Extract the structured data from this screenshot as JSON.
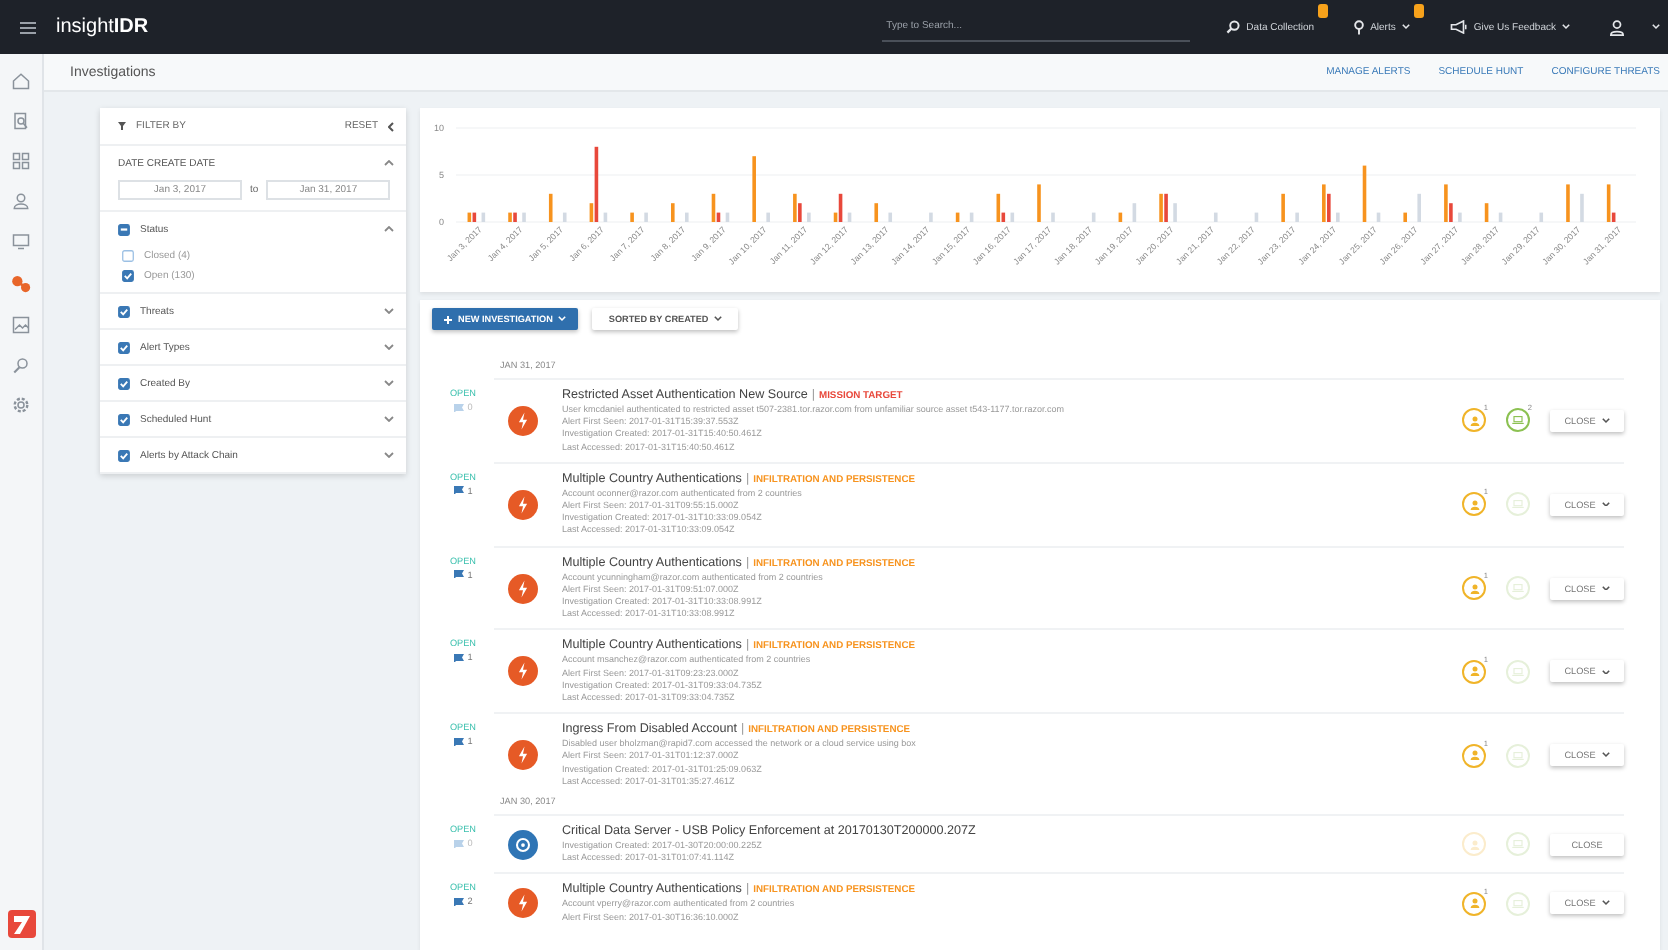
{
  "topbar": {
    "logo": "insight**IDR**",
    "search": {
      "placeholder": "Type to Search..."
    },
    "items": [
      {
        "kind": "collection",
        "label": "Data Collection",
        "badge": true,
        "caret": false
      },
      {
        "kind": "alerts",
        "label": "Alerts",
        "badge": true,
        "caret": true
      },
      {
        "kind": "feedback",
        "label": "Give Us Feedback",
        "badge": false,
        "caret": true
      }
    ]
  },
  "sidebar": {
    "items": [
      {
        "kind": "home",
        "selected": false
      },
      {
        "kind": "report",
        "selected": false
      },
      {
        "kind": "dashboard",
        "selected": false
      },
      {
        "kind": "user",
        "selected": false
      },
      {
        "kind": "monitor",
        "selected": false
      },
      {
        "kind": "investigation",
        "selected": true
      },
      {
        "kind": "image",
        "selected": false
      },
      {
        "kind": "hunt",
        "selected": false
      },
      {
        "kind": "settings",
        "selected": false
      }
    ]
  },
  "header": {
    "title": "Investigations",
    "links": [
      "MANAGE ALERTS",
      "SCHEDULE HUNT",
      "CONFIGURE THREATS"
    ]
  },
  "filter": {
    "title": "FILTER BY",
    "reset": "RESET",
    "date": {
      "label": "DATE CREATE DATE",
      "expanded": true,
      "from": "Jan 3, 2017",
      "separator": "to",
      "to": "Jan 31, 2017"
    },
    "groups": [
      {
        "label": "Status",
        "checked": true,
        "partial": true,
        "expanded": true,
        "options": [
          {
            "label": "Closed (4)",
            "checked": false
          },
          {
            "label": "Open (130)",
            "checked": true
          }
        ]
      },
      {
        "label": "Threats",
        "checked": true,
        "expanded": false
      },
      {
        "label": "Alert Types",
        "checked": true,
        "expanded": false
      },
      {
        "label": "Created By",
        "checked": true,
        "expanded": false
      },
      {
        "label": "Scheduled Hunt",
        "checked": true,
        "expanded": false
      },
      {
        "label": "Alerts by Attack Chain",
        "checked": true,
        "expanded": false
      }
    ]
  },
  "chart_data": {
    "type": "bar",
    "ylim": [
      0,
      10
    ],
    "yticks": [
      0,
      5,
      10
    ],
    "categories": [
      "Jan 3, 2017",
      "Jan 4, 2017",
      "Jan 5, 2017",
      "Jan 6, 2017",
      "Jan 7, 2017",
      "Jan 8, 2017",
      "Jan 9, 2017",
      "Jan 10, 2017",
      "Jan 11, 2017",
      "Jan 12, 2017",
      "Jan 13, 2017",
      "Jan 14, 2017",
      "Jan 15, 2017",
      "Jan 16, 2017",
      "Jan 17, 2017",
      "Jan 18, 2017",
      "Jan 19, 2017",
      "Jan 20, 2017",
      "Jan 21, 2017",
      "Jan 22, 2017",
      "Jan 23, 2017",
      "Jan 24, 2017",
      "Jan 25, 2017",
      "Jan 26, 2017",
      "Jan 27, 2017",
      "Jan 28, 2017",
      "Jan 29, 2017",
      "Jan 30, 2017",
      "Jan 31, 2017"
    ],
    "series": [
      {
        "color": "#f7931e",
        "values": [
          1,
          1,
          3,
          2,
          1,
          2,
          3,
          7,
          3,
          1,
          2,
          0,
          1,
          3,
          4,
          0,
          1,
          3,
          0,
          0,
          3,
          4,
          6,
          1,
          4,
          2,
          0,
          4,
          4
        ]
      },
      {
        "color": "#e8483b",
        "values": [
          1,
          1,
          0,
          8,
          0,
          0,
          1,
          0,
          2,
          3,
          0,
          0,
          0,
          1,
          0,
          0,
          0,
          3,
          0,
          0,
          0,
          3,
          0,
          0,
          2,
          0,
          0,
          0,
          1
        ]
      },
      {
        "color": "#d3dae3",
        "values": [
          1,
          1,
          1,
          1,
          1,
          1,
          1,
          1,
          1,
          1,
          1,
          1,
          1,
          1,
          1,
          1,
          2,
          2,
          1,
          1,
          1,
          1,
          1,
          3,
          1,
          1,
          1,
          3,
          0
        ]
      }
    ]
  },
  "actions": {
    "new_button": "NEW INVESTIGATION",
    "sort_button": "SORTED BY CREATED"
  },
  "groups": [
    {
      "date": "JAN 31, 2017",
      "items": [
        {
          "status": "OPEN",
          "flags": "0",
          "flagged": false,
          "kind": "alert",
          "title": "Restricted Asset Authentication New Source",
          "separator": "|",
          "tag": {
            "text": "MISSION TARGET",
            "color": "#e8483b"
          },
          "lines": [
            "User kmcdaniel authenticated to restricted asset t507-2381.tor.razor.com from unfamiliar source asset t543-1177.tor.razor.com",
            "Alert First Seen: 2017-01-31T15:39:37.553Z",
            "Investigation Created: 2017-01-31T15:40:50.461Z",
            "Last Accessed: 2017-01-31T15:40:50.461Z"
          ],
          "users": {
            "active": true,
            "count": "1"
          },
          "assets": {
            "active": true,
            "count": "2"
          },
          "close": {
            "label": "CLOSE",
            "menu": true
          }
        },
        {
          "status": "OPEN",
          "flags": "1",
          "flagged": true,
          "kind": "alert",
          "title": "Multiple Country Authentications",
          "separator": "|",
          "tag": {
            "text": "INFILTRATION AND PERSISTENCE",
            "color": "#f7931e"
          },
          "lines": [
            "Account oconner@razor.com authenticated from 2 countries",
            "Alert First Seen: 2017-01-31T09:55:15.000Z",
            "Investigation Created: 2017-01-31T10:33:09.054Z",
            "Last Accessed: 2017-01-31T10:33:09.054Z"
          ],
          "users": {
            "active": true,
            "count": "1"
          },
          "assets": {
            "active": false
          },
          "close": {
            "label": "CLOSE",
            "menu": true
          }
        },
        {
          "status": "OPEN",
          "flags": "1",
          "flagged": true,
          "kind": "alert",
          "title": "Multiple Country Authentications",
          "separator": "|",
          "tag": {
            "text": "INFILTRATION AND PERSISTENCE",
            "color": "#f7931e"
          },
          "lines": [
            "Account ycunningham@razor.com authenticated from 2 countries",
            "Alert First Seen: 2017-01-31T09:51:07.000Z",
            "Investigation Created: 2017-01-31T10:33:08.991Z",
            "Last Accessed: 2017-01-31T10:33:08.991Z"
          ],
          "users": {
            "active": true,
            "count": "1"
          },
          "assets": {
            "active": false
          },
          "close": {
            "label": "CLOSE",
            "menu": true
          }
        },
        {
          "status": "OPEN",
          "flags": "1",
          "flagged": true,
          "kind": "alert",
          "title": "Multiple Country Authentications",
          "separator": "|",
          "tag": {
            "text": "INFILTRATION AND PERSISTENCE",
            "color": "#f7931e"
          },
          "lines": [
            "Account msanchez@razor.com authenticated from 2 countries",
            "Alert First Seen: 2017-01-31T09:23:23.000Z",
            "Investigation Created: 2017-01-31T09:33:04.735Z",
            "Last Accessed: 2017-01-31T09:33:04.735Z"
          ],
          "users": {
            "active": true,
            "count": "1"
          },
          "assets": {
            "active": false
          },
          "close": {
            "label": "CLOSE",
            "menu": true
          }
        },
        {
          "status": "OPEN",
          "flags": "1",
          "flagged": true,
          "kind": "alert",
          "title": "Ingress From Disabled Account",
          "separator": "|",
          "tag": {
            "text": "INFILTRATION AND PERSISTENCE",
            "color": "#f7931e"
          },
          "lines": [
            "Disabled user bholzman@rapid7.com accessed the network or a cloud service using box",
            "Alert First Seen: 2017-01-31T01:12:37.000Z",
            "Investigation Created: 2017-01-31T01:25:09.063Z",
            "Last Accessed: 2017-01-31T01:35:27.461Z"
          ],
          "users": {
            "active": true,
            "count": "1"
          },
          "assets": {
            "active": false
          },
          "close": {
            "label": "CLOSE",
            "menu": true
          }
        }
      ]
    },
    {
      "date": "JAN 30, 2017",
      "items": [
        {
          "status": "OPEN",
          "flags": "0",
          "flagged": false,
          "kind": "hunt",
          "title": "Critical Data Server - USB Policy Enforcement at 20170130T200000.207Z",
          "lines": [
            "Investigation Created: 2017-01-30T20:00:00.225Z",
            "Last Accessed: 2017-01-31T01:07:41.114Z"
          ],
          "users": {
            "active": false
          },
          "assets": {
            "active": false
          },
          "close": {
            "label": "CLOSE",
            "menu": false
          }
        },
        {
          "status": "OPEN",
          "flags": "2",
          "flagged": true,
          "kind": "alert",
          "title": "Multiple Country Authentications",
          "separator": "|",
          "tag": {
            "text": "INFILTRATION AND PERSISTENCE",
            "color": "#f7931e"
          },
          "lines": [
            "Account vperry@razor.com authenticated from 2 countries",
            "Alert First Seen: 2017-01-30T16:36:10.000Z"
          ],
          "users": {
            "active": true,
            "count": "1"
          },
          "assets": {
            "active": false
          },
          "close": {
            "label": "CLOSE",
            "menu": true
          }
        }
      ]
    }
  ]
}
